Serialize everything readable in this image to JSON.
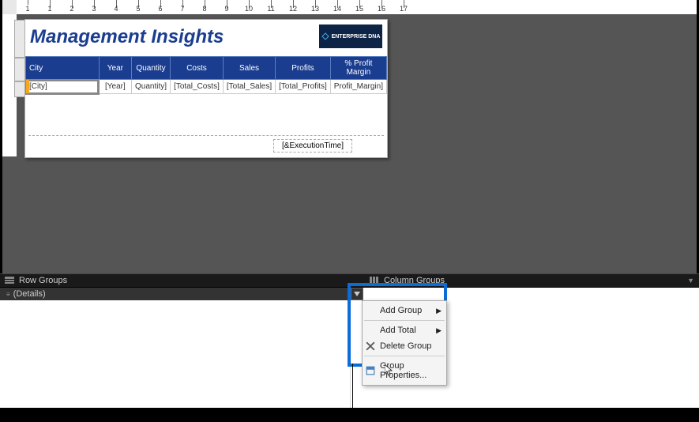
{
  "report": {
    "title": "Management Insights",
    "logo_text": "ENTERPRISE DNA",
    "columns": [
      "City",
      "Year",
      "Quantity",
      "Costs",
      "Sales",
      "Profits",
      "% Profit Margin"
    ],
    "row": [
      "[City]",
      "[Year]",
      "Quantity]",
      "[Total_Costs]",
      "[Total_Sales]",
      "[Total_Profits]",
      "Profit_Margin]"
    ],
    "footer": "[&ExecutionTime]"
  },
  "ruler_numbers": [
    "1",
    "1",
    "2",
    "3",
    "4",
    "5",
    "6",
    "7",
    "8",
    "9",
    "10",
    "11",
    "12",
    "13",
    "14",
    "15",
    "16",
    "17"
  ],
  "groups": {
    "row_label": "Row Groups",
    "column_label": "Column Groups",
    "details": "(Details)"
  },
  "menu": {
    "add_group": "Add Group",
    "add_total": "Add Total",
    "delete_group": "Delete Group",
    "group_properties": "Group Properties..."
  }
}
